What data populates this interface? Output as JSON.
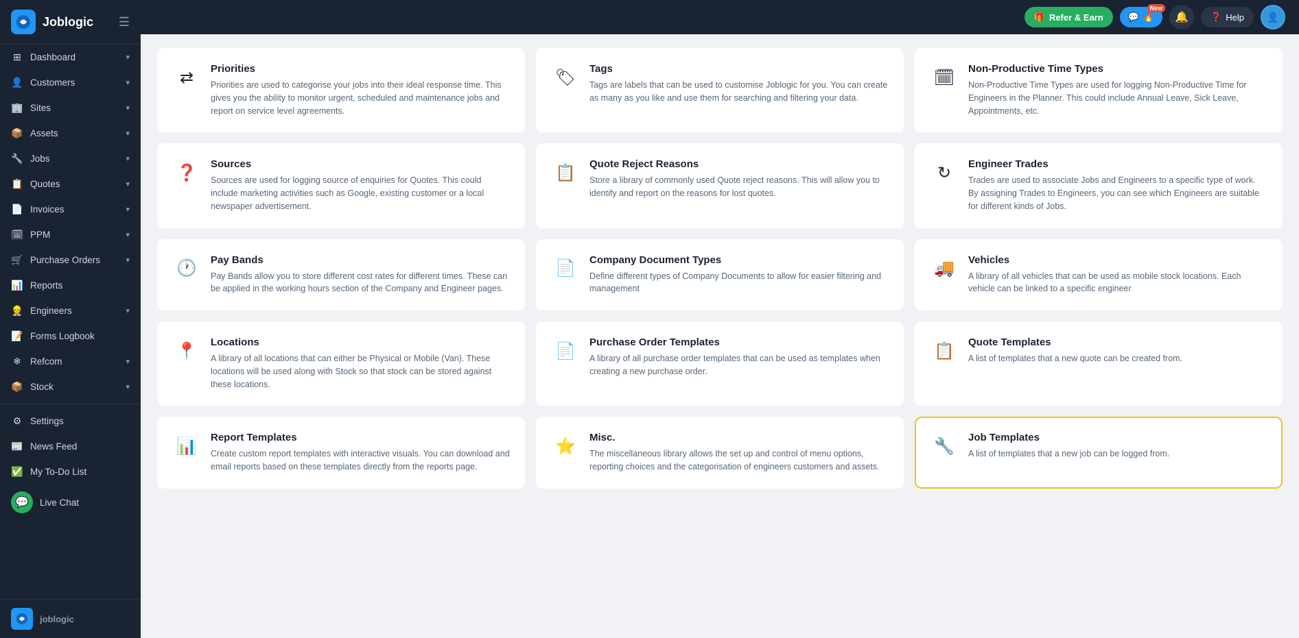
{
  "app": {
    "name": "Joblogic",
    "logo_text": "JL",
    "bottom_logo_text": "JL",
    "bottom_brand": "joblogic"
  },
  "topbar": {
    "refer_label": "Refer & Earn",
    "chat_label": "New",
    "help_label": "Help",
    "notification_icon": "🔔"
  },
  "sidebar": {
    "items": [
      {
        "id": "dashboard",
        "label": "Dashboard",
        "icon": "⊞",
        "has_arrow": true
      },
      {
        "id": "customers",
        "label": "Customers",
        "icon": "👤",
        "has_arrow": true
      },
      {
        "id": "sites",
        "label": "Sites",
        "icon": "🏢",
        "has_arrow": true
      },
      {
        "id": "assets",
        "label": "Assets",
        "icon": "📦",
        "has_arrow": true
      },
      {
        "id": "jobs",
        "label": "Jobs",
        "icon": "🔧",
        "has_arrow": true
      },
      {
        "id": "quotes",
        "label": "Quotes",
        "icon": "📋",
        "has_arrow": true
      },
      {
        "id": "invoices",
        "label": "Invoices",
        "icon": "📄",
        "has_arrow": true
      },
      {
        "id": "ppm",
        "label": "PPM",
        "icon": "🗓",
        "has_arrow": true
      },
      {
        "id": "purchase-orders",
        "label": "Purchase Orders",
        "icon": "🛒",
        "has_arrow": true
      },
      {
        "id": "reports",
        "label": "Reports",
        "icon": "📊",
        "has_arrow": false
      },
      {
        "id": "engineers",
        "label": "Engineers",
        "icon": "👷",
        "has_arrow": true
      },
      {
        "id": "forms-logbook",
        "label": "Forms Logbook",
        "icon": "📝",
        "has_arrow": false
      },
      {
        "id": "refcom",
        "label": "Refcom",
        "icon": "❄",
        "has_arrow": true
      },
      {
        "id": "stock",
        "label": "Stock",
        "icon": "📦",
        "has_arrow": true
      }
    ],
    "bottom_items": [
      {
        "id": "settings",
        "label": "Settings",
        "icon": "⚙"
      },
      {
        "id": "news-feed",
        "label": "News Feed",
        "icon": "📰"
      },
      {
        "id": "my-todo",
        "label": "My To-Do List",
        "icon": "✅"
      }
    ],
    "live_chat_label": "Live Chat"
  },
  "cards": [
    {
      "id": "priorities",
      "title": "Priorities",
      "desc": "Priorities are used to categorise your jobs into their ideal response time.\nThis gives you the ability to monitor urgent, scheduled and maintenance jobs and report on service level agreements.",
      "icon": "⇄",
      "highlighted": false
    },
    {
      "id": "tags",
      "title": "Tags",
      "desc": "Tags are labels that can be used to customise Joblogic for you. You can create as many as you like and use them for searching and filtering your data.",
      "icon": "🏷",
      "highlighted": false
    },
    {
      "id": "non-productive-time-types",
      "title": "Non-Productive Time Types",
      "desc": "Non-Productive Time Types are used for logging Non-Productive Time for Engineers in the Planner.\nThis could include Annual Leave, Sick Leave, Appointments, etc.",
      "icon": "🗓",
      "highlighted": false
    },
    {
      "id": "sources",
      "title": "Sources",
      "desc": "Sources are used for logging source of enquiries for Quotes. This could include marketing activities such as Google, existing customer or a local newspaper advertisement.",
      "icon": "❓",
      "highlighted": false
    },
    {
      "id": "quote-reject-reasons",
      "title": "Quote Reject Reasons",
      "desc": "Store a library of commonly used Quote reject reasons. This will allow you to identify and report on the reasons for lost quotes.",
      "icon": "📋",
      "highlighted": false
    },
    {
      "id": "engineer-trades",
      "title": "Engineer Trades",
      "desc": "Trades are used to associate Jobs and Engineers to a specific type of work. By assigning Trades to Engineers, you can see which Engineers are suitable for different kinds of Jobs.",
      "icon": "↻",
      "highlighted": false
    },
    {
      "id": "pay-bands",
      "title": "Pay Bands",
      "desc": "Pay Bands allow you to store different cost rates for different times. These can be applied in the working hours section of the Company and Engineer pages.",
      "icon": "🕐",
      "highlighted": false
    },
    {
      "id": "company-document-types",
      "title": "Company Document Types",
      "desc": "Define different types of Company Documents to allow for easier filtering and management",
      "icon": "📄",
      "highlighted": false
    },
    {
      "id": "vehicles",
      "title": "Vehicles",
      "desc": "A library of all vehicles that can be used as mobile stock locations. Each vehicle can be linked to a specific engineer",
      "icon": "🚚",
      "highlighted": false
    },
    {
      "id": "locations",
      "title": "Locations",
      "desc": "A library of all locations that can either be Physical or Mobile (Van). These locations will be used along with Stock so that stock can be stored against these locations.",
      "icon": "📍",
      "highlighted": false
    },
    {
      "id": "purchase-order-templates",
      "title": "Purchase Order Templates",
      "desc": "A library of all purchase order templates that can be used as templates when creating a new purchase order.",
      "icon": "📄",
      "highlighted": false
    },
    {
      "id": "quote-templates",
      "title": "Quote Templates",
      "desc": "A list of templates that a new quote can be created from.",
      "icon": "📋",
      "highlighted": false
    },
    {
      "id": "report-templates",
      "title": "Report Templates",
      "desc": "Create custom report templates with interactive visuals. You can download and email reports based on these templates directly from the reports page.",
      "icon": "📊",
      "highlighted": false
    },
    {
      "id": "misc",
      "title": "Misc.",
      "desc": "The miscellaneous library allows the set up and control of menu options, reporting choices and the categorisation of engineers customers and assets.",
      "icon": "⭐",
      "highlighted": false
    },
    {
      "id": "job-templates",
      "title": "Job Templates",
      "desc": "A list of templates that a new job can be logged from.",
      "icon": "🔧",
      "highlighted": true
    }
  ]
}
